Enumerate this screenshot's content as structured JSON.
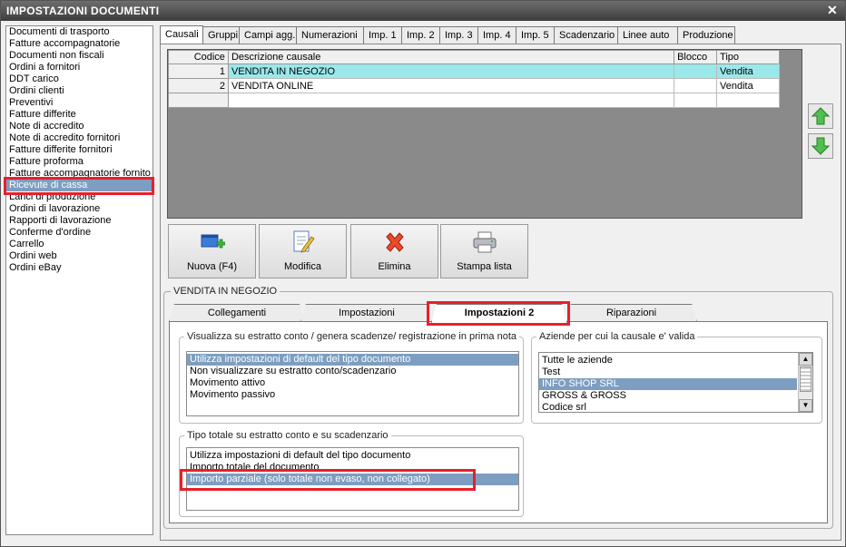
{
  "window": {
    "title": "IMPOSTAZIONI DOCUMENTI",
    "close_glyph": "✕"
  },
  "doc_types": [
    "Documenti di trasporto",
    "Fatture accompagnatorie",
    "Documenti non fiscali",
    "Ordini a fornitori",
    "DDT carico",
    "Ordini clienti",
    "Preventivi",
    "Fatture differite",
    "Note di accredito",
    "Note di accredito fornitori",
    "Fatture differite fornitori",
    "Fatture proforma",
    "Fatture accompagnatorie fornito",
    "Ricevute di cassa",
    "Lanci di produzione",
    "Ordini di lavorazione",
    "Rapporti di lavorazione",
    "Conferme d'ordine",
    "Carrello",
    "Ordini web",
    "Ordini eBay"
  ],
  "doc_types_selected": "Ricevute di cassa",
  "tabs": [
    "Causali",
    "Gruppi",
    "Campi agg.",
    "Numerazioni",
    "Imp. 1",
    "Imp. 2",
    "Imp. 3",
    "Imp. 4",
    "Imp. 5",
    "Scadenzario",
    "Linee auto",
    "Produzione"
  ],
  "active_tab": "Causali",
  "grid": {
    "columns": [
      "Codice",
      "Descrizione causale",
      "Blocco",
      "Tipo"
    ],
    "rows": [
      {
        "codice": "1",
        "descrizione": "VENDITA IN NEGOZIO",
        "blocco": "",
        "tipo": "Vendita"
      },
      {
        "codice": "2",
        "descrizione": "VENDITA ONLINE",
        "blocco": "",
        "tipo": "Vendita"
      }
    ]
  },
  "toolbar": {
    "new_label": "Nuova (F4)",
    "edit_label": "Modifica",
    "delete_label": "Elimina",
    "print_label": "Stampa lista"
  },
  "detail": {
    "group_title": "VENDITA IN NEGOZIO",
    "tabs": [
      "Collegamenti",
      "Impostazioni",
      "Impostazioni 2",
      "Riparazioni"
    ],
    "active_tab": "Impostazioni 2",
    "estratto": {
      "label": "Visualizza su estratto conto / genera scadenze/ registrazione  in prima nota",
      "options": [
        "Utilizza impostazioni di default del tipo documento",
        "Non visualizzare su estratto conto/scadenzario",
        "Movimento attivo",
        "Movimento passivo"
      ],
      "selected": "Utilizza impostazioni di default del tipo documento"
    },
    "aziende": {
      "label": "Aziende per cui la causale e' valida",
      "options": [
        "Tutte le aziende",
        "Test",
        "INFO SHOP SRL",
        "GROSS & GROSS",
        "Codice srl"
      ],
      "selected": "INFO SHOP SRL"
    },
    "tipo_totale": {
      "label": "Tipo totale su estratto conto e su scadenzario",
      "options": [
        "Utilizza impostazioni di default del tipo documento",
        "Importo totale del documento",
        "Importo parziale (solo totale non evaso, non collegato)"
      ],
      "selected": "Importo parziale (solo totale non evaso, non collegato)"
    }
  },
  "colors": {
    "selection": "#7d9ec0",
    "grid_selected_row": "#9ae8ea",
    "highlight_box": "#e8202a"
  }
}
